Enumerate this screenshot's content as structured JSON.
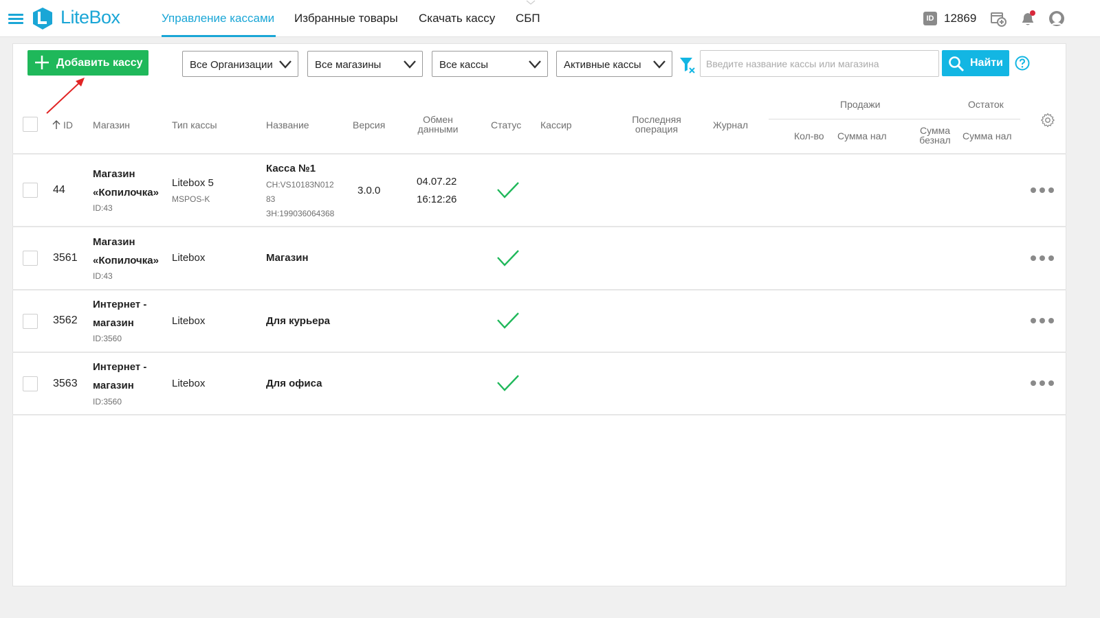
{
  "app": {
    "logo_text": "LiteBox",
    "brand_color": "#1aa6d6",
    "accent_green": "#1fb85a",
    "nav": [
      {
        "label": "Управление кассами",
        "active": true
      },
      {
        "label": "Избранные товары",
        "active": false
      },
      {
        "label": "Скачать кассу",
        "active": false
      },
      {
        "label": "СБП",
        "active": false
      }
    ],
    "id_badge": "ID",
    "user_id": "12869",
    "icons": [
      "menu-icon",
      "add-device-icon",
      "bell-icon",
      "user-icon"
    ]
  },
  "toolbar": {
    "add_label": "Добавить кассу",
    "filters": [
      {
        "value": "Все Организации"
      },
      {
        "value": "Все магазины"
      },
      {
        "value": "Все кассы"
      },
      {
        "value": "Активные кассы"
      }
    ],
    "search_placeholder": "Введите название кассы или магазина",
    "find_label": "Найти"
  },
  "table": {
    "headers": {
      "id": "ID",
      "shop": "Магазин",
      "type": "Тип кассы",
      "name": "Название",
      "version": "Версия",
      "exchange_1": "Обмен",
      "exchange_2": "данными",
      "status": "Статус",
      "cashier": "Кассир",
      "last_op_1": "Последняя",
      "last_op_2": "операция",
      "journal": "Журнал",
      "sales_group": "Продажи",
      "rest_group": "Остаток",
      "qty": "Кол-во",
      "sum_cash": "Сумма нал",
      "sum_noncash_1": "Сумма",
      "sum_noncash_2": "безнал",
      "rest_cash": "Сумма нал"
    },
    "rows": [
      {
        "id": "44",
        "shop_1": "Магазин",
        "shop_2": "«Копилочка»",
        "shop_id": "ID:43",
        "type": "Litebox 5",
        "type_sub": "MSPOS-K",
        "name": "Касса №1",
        "sn_1": "СН:VS10183N012",
        "sn_2": "83",
        "zn": "ЗН:199036064368",
        "version": "3.0.0",
        "date": "04.07.22",
        "time": "16:12:26",
        "status": "active"
      },
      {
        "id": "3561",
        "shop_1": "Магазин",
        "shop_2": "«Копилочка»",
        "shop_id": "ID:43",
        "type": "Litebox",
        "name": "Магазин",
        "status": "active"
      },
      {
        "id": "3562",
        "shop_1": "Интернет -",
        "shop_2": "магазин",
        "shop_id": "ID:3560",
        "type": "Litebox",
        "name": "Для курьера",
        "status": "active"
      },
      {
        "id": "3563",
        "shop_1": "Интернет -",
        "shop_2": "магазин",
        "shop_id": "ID:3560",
        "type": "Litebox",
        "name": "Для офиса",
        "status": "active"
      }
    ]
  }
}
